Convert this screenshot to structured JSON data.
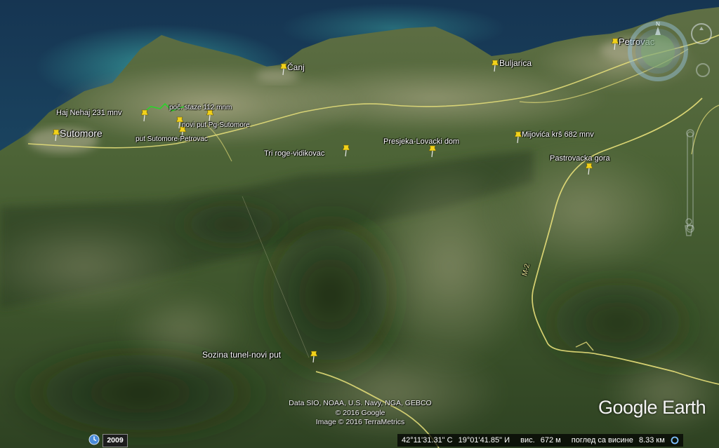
{
  "map": {
    "provider": "Google Earth",
    "brand": "Google Earth",
    "colors": {
      "sea_deep": "#1a3f5c",
      "sea_shallow": "#2f8e8c",
      "terrain_dark": "#2f4526",
      "terrain_mid": "#5b6f43",
      "terrain_light": "#9aa27a",
      "road": "#e8e07a",
      "pin": "#f2d21a",
      "path_green": "#2bd32b"
    },
    "placemarks": [
      {
        "id": "sutomore",
        "label": "Sutomore",
        "icon": "yellow-pushpin-icon"
      },
      {
        "id": "haj-nehaj",
        "label": "Haj Nehaj 231 mnv",
        "icon": "yellow-pushpin-icon"
      },
      {
        "id": "poc-staze",
        "label": "poč. staze 112 mnm",
        "icon": "yellow-pushpin-icon"
      },
      {
        "id": "novi-put",
        "label": "novi put Pg-Sutomore",
        "icon": "yellow-pushpin-icon"
      },
      {
        "id": "put-sutomore",
        "label": "put Sutomore-Petrovac",
        "icon": "yellow-pushpin-icon"
      },
      {
        "id": "canj",
        "label": "Čanj",
        "icon": "yellow-pushpin-icon"
      },
      {
        "id": "buljarica",
        "label": "Buljarica",
        "icon": "yellow-pushpin-icon"
      },
      {
        "id": "petrovac",
        "label": "Petrovac",
        "icon": "yellow-pushpin-icon"
      },
      {
        "id": "tri-roge",
        "label": "Tri roge-vidikovac",
        "icon": "yellow-pushpin-icon"
      },
      {
        "id": "presjeka",
        "label": "Presjeka-Lovacki dom",
        "icon": "yellow-pushpin-icon"
      },
      {
        "id": "mijovica",
        "label": "Mijovića krš 682 mnv",
        "icon": "yellow-pushpin-icon"
      },
      {
        "id": "pastrovacka",
        "label": "Pastrovacka gora",
        "icon": "yellow-pushpin-icon"
      },
      {
        "id": "sozina",
        "label": "Sozina tunel-novi put",
        "icon": "yellow-pushpin-icon"
      }
    ],
    "road_label": "M-2",
    "credits": [
      "Data SIO, NOAA, U.S. Navy, NGA, GEBCO",
      "© 2016 Google",
      "Image © 2016 TerraMetrics"
    ]
  },
  "status_bar": {
    "year": "2009",
    "latitude": "42°11'31.31\" С",
    "longitude": "19°01'41.85\" И",
    "elevation_label": "вис.",
    "elevation_value": "672 м",
    "eye_alt_label": "поглед са висине",
    "eye_alt_value": "8.33 км",
    "icons": {
      "history": "clock-icon",
      "streaming": "streaming-ring-icon"
    }
  },
  "controls": {
    "compass_letter": "N",
    "compass_icon": "compass-icon",
    "look_icon": "look-joystick-icon",
    "move_icon": "move-joystick-icon",
    "zoom_icon": "zoom-slider-icon",
    "pegman_icon": "street-view-pegman-icon"
  }
}
